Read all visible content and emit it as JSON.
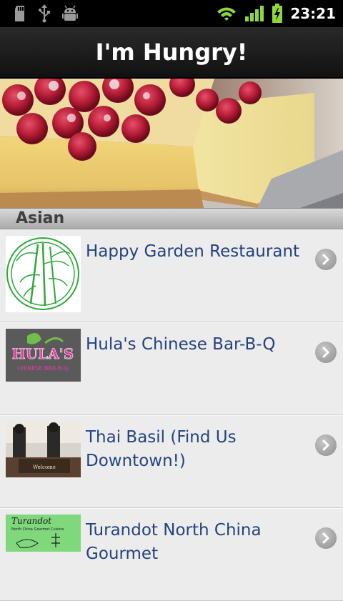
{
  "status_bar": {
    "time": "23:21",
    "left_icons": [
      "sd-card-icon",
      "usb-icon",
      "android-debug-icon"
    ],
    "right_icons": [
      "wifi-icon",
      "signal-icon",
      "battery-charging-icon"
    ]
  },
  "app": {
    "title": "I'm Hungry!"
  },
  "hero": {
    "image": "cheesecake-with-raspberries"
  },
  "section": {
    "label": "Asian"
  },
  "restaurants": [
    {
      "name": "Happy Garden Restaurant"
    },
    {
      "name": "Hula's Chinese Bar-B-Q",
      "logo_text_1": "HULA'S",
      "logo_text_2": "CHINESE BAR-B-Q"
    },
    {
      "name": "Thai Basil (Find Us Downtown!)",
      "logo_text": "Welcome"
    },
    {
      "name": "Turandot North China Gourmet",
      "logo_text_1": "Turandot",
      "logo_text_2": "North China Gourmet Cuisine"
    }
  ],
  "colors": {
    "link_text": "#24427e",
    "list_background": "#ececec"
  }
}
